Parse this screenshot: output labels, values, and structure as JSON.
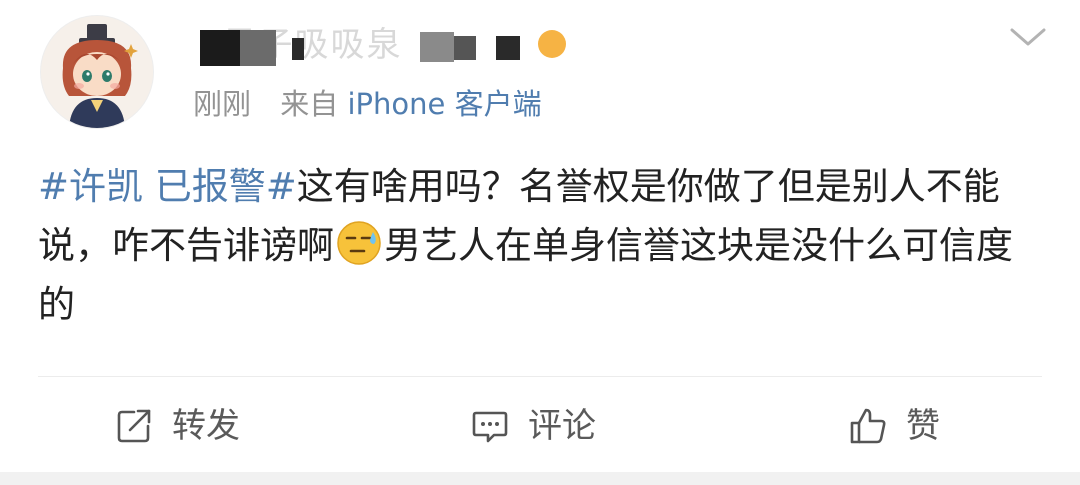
{
  "post": {
    "author": {
      "name_obscured": "P星子吸吸泉",
      "avatar_icon": "cartoon-avatar-icon"
    },
    "meta": {
      "time": "刚刚",
      "source": "来自",
      "source_link": "iPhone 客户端"
    },
    "body": {
      "hashtag": "#许凯 已报警#",
      "text_part1": "这有啥用吗？名誉权是你做了但是别人不能说，咋不告诽谤啊",
      "emoji": "sweat-emoji",
      "text_part2": "男艺人在单身信誉这块是没什么可信度的"
    },
    "actions": {
      "repost_label": "转发",
      "comment_label": "评论",
      "like_label": "赞"
    },
    "menu_icon": "chevron-down-icon"
  },
  "colors": {
    "link": "#507DAF",
    "text": "#222222",
    "meta": "#939393",
    "action_text": "#5a5a5a"
  }
}
